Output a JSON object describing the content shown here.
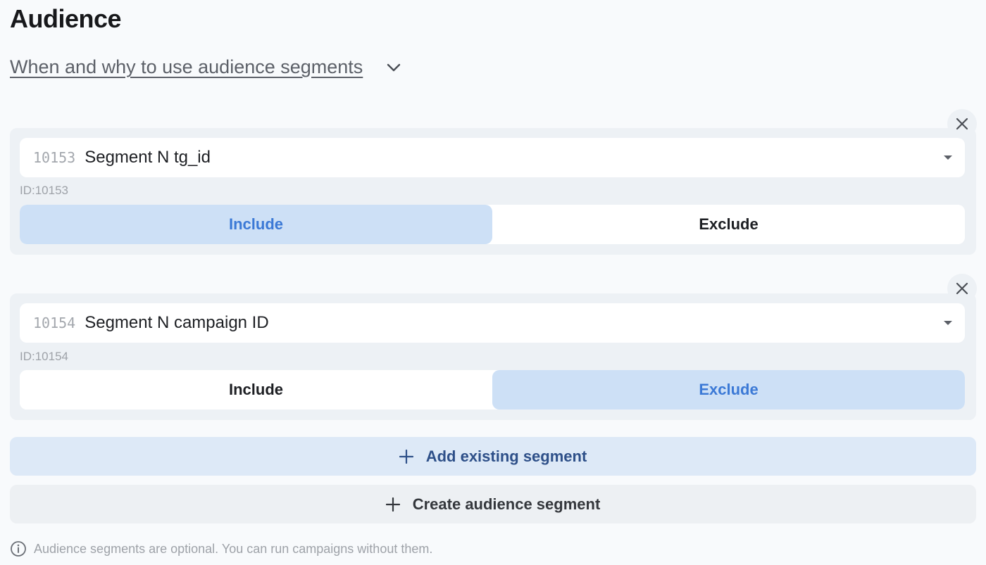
{
  "header": {
    "title": "Audience",
    "help_link": "When and why to use audience segments"
  },
  "segments": [
    {
      "number": "10153",
      "name": "Segment N tg_id",
      "id_label": "ID:10153",
      "include_label": "Include",
      "exclude_label": "Exclude",
      "selected_mode": "Include"
    },
    {
      "number": "10154",
      "name": "Segment N campaign ID",
      "id_label": "ID:10154",
      "include_label": "Include",
      "exclude_label": "Exclude",
      "selected_mode": "Exclude"
    }
  ],
  "actions": {
    "add_existing": "Add existing segment",
    "create_segment": "Create audience segment"
  },
  "footer": {
    "note": "Audience segments are optional. You can run campaigns without them."
  },
  "icons": {
    "chevron": "chevron-down-icon",
    "close": "close-icon",
    "caret": "caret-down-icon",
    "plus": "plus-icon",
    "info": "info-icon"
  },
  "colors": {
    "active_toggle_bg": "#cde0f6",
    "active_toggle_text": "#3b79d6",
    "add_button_bg": "#dde9f7",
    "add_button_text": "#2e5089"
  }
}
